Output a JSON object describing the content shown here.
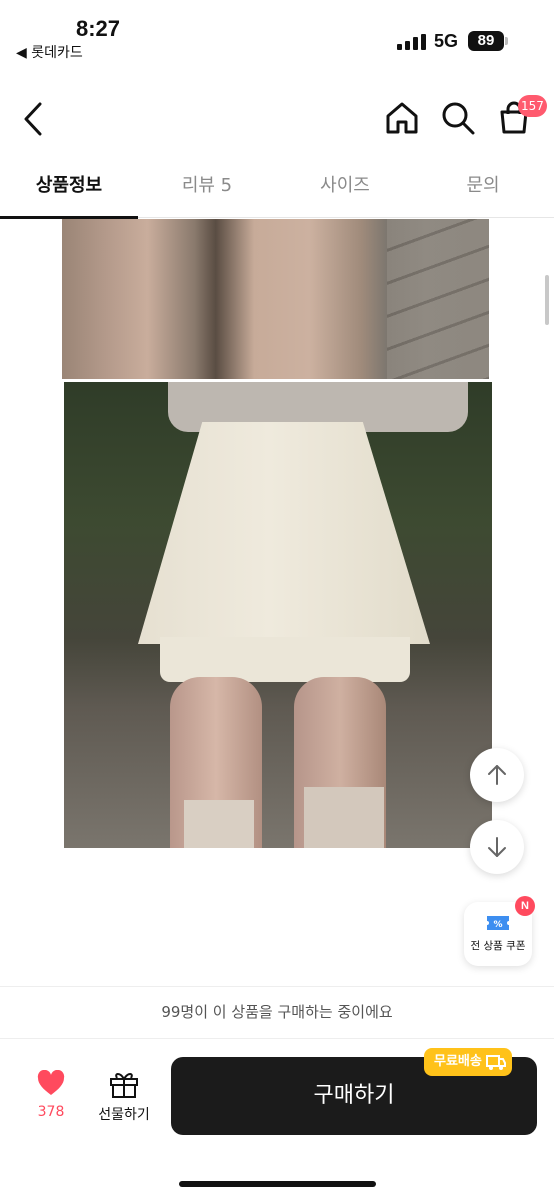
{
  "status_bar": {
    "time": "8:27",
    "back_app": "◀ 롯데카드",
    "network": "5G",
    "battery": "89"
  },
  "header": {
    "cart_count": "157"
  },
  "tabs": [
    {
      "label": "상품정보",
      "active": true
    },
    {
      "label": "리뷰 5",
      "active": false
    },
    {
      "label": "사이즈",
      "active": false
    },
    {
      "label": "문의",
      "active": false
    }
  ],
  "coupon": {
    "badge": "N",
    "label": "전 상품 쿠폰"
  },
  "buyers_notice": "99명이 이 상품을 구매하는 중이에요",
  "bottom_bar": {
    "like_count": "378",
    "gift_label": "선물하기",
    "buy_label": "구매하기",
    "shipping_tag": "무료배송"
  },
  "colors": {
    "accent": "#ff4a5e",
    "buy_button": "#1b1b1b",
    "shipping_tag": "#ffc21a"
  }
}
